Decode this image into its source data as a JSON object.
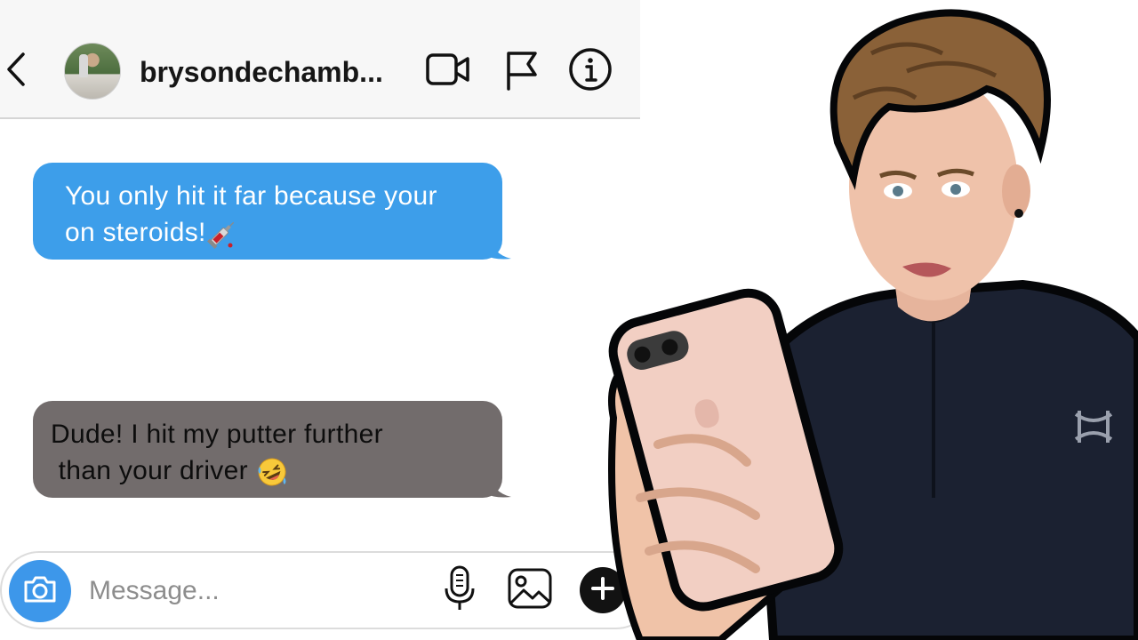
{
  "header": {
    "username": "brysondechamb...",
    "icons": {
      "back": "chevron-left-icon",
      "video": "video-camera-icon",
      "flag": "flag-icon",
      "info": "info-icon"
    }
  },
  "messages": [
    {
      "direction": "sent",
      "lines": [
        "You only hit it far because your",
        "on steroids!"
      ],
      "emoji": "syringe-emoji"
    },
    {
      "direction": "received",
      "lines": [
        "Dude! I hit my putter further",
        " than your driver "
      ],
      "emoji": "rolling-laughing-emoji"
    }
  ],
  "composer": {
    "placeholder": "Message...",
    "icons": {
      "camera": "camera-icon",
      "mic": "microphone-icon",
      "gallery": "image-icon",
      "add": "plus-icon"
    }
  },
  "colors": {
    "sent_bubble": "#3d9eea",
    "received_bubble": "#726c6c",
    "camera_button": "#3d97ea",
    "header_bg": "#f7f7f7"
  }
}
